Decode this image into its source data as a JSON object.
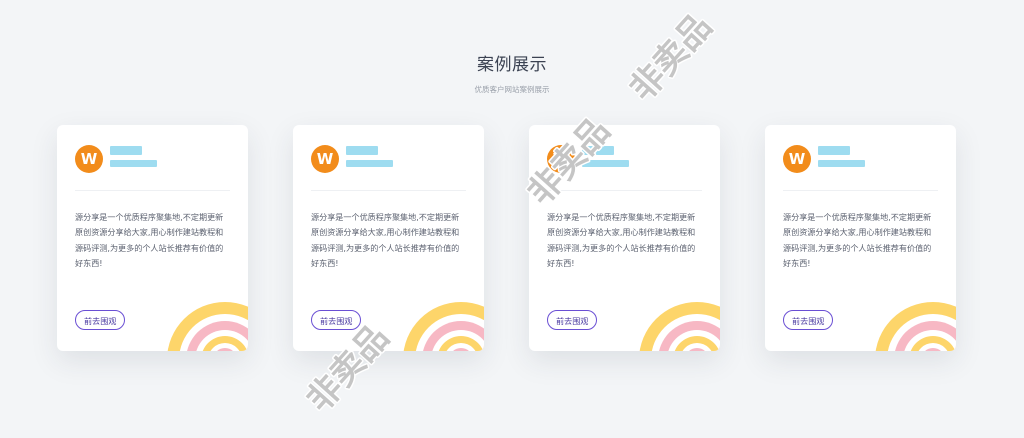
{
  "section": {
    "title": "案例展示",
    "subtitle": "优质客户网站案例展示"
  },
  "cards": [
    {
      "avatar_letter": "W",
      "description": "源分享是一个优质程序聚集地,不定期更新原创资源分享给大家,用心制作建站教程和源码评测,为更多的个人站长推荐有价值的好东西!",
      "button_label": "前去围观"
    },
    {
      "avatar_letter": "W",
      "description": "源分享是一个优质程序聚集地,不定期更新原创资源分享给大家,用心制作建站教程和源码评测,为更多的个人站长推荐有价值的好东西!",
      "button_label": "前去围观"
    },
    {
      "avatar_letter": "W",
      "description": "源分享是一个优质程序聚集地,不定期更新原创资源分享给大家,用心制作建站教程和源码评测,为更多的个人站长推荐有价值的好东西!",
      "button_label": "前去围观"
    },
    {
      "avatar_letter": "W",
      "description": "源分享是一个优质程序聚集地,不定期更新原创资源分享给大家,用心制作建站教程和源码评测,为更多的个人站长推荐有价值的好东西!",
      "button_label": "前去围观"
    }
  ],
  "watermark": [
    "非卖品",
    "非卖品",
    "非卖品"
  ],
  "colors": {
    "accent": "#6a4fd4",
    "avatar": "#f28c1b",
    "rainbow_outer": "#fdd56a",
    "rainbow_mid": "#f7b8c4",
    "placeholder": "#9edcf0"
  }
}
